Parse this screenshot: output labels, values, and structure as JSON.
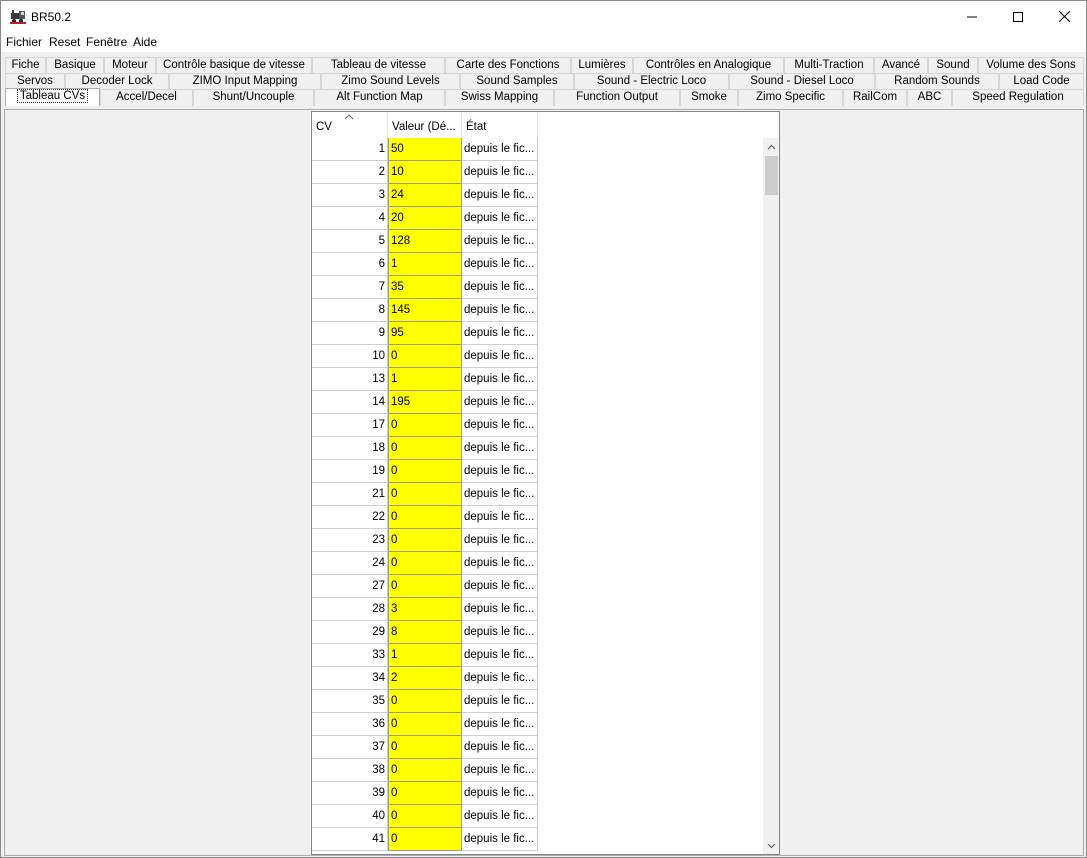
{
  "window": {
    "title": "BR50.2"
  },
  "menu": [
    "Fichier",
    "Reset",
    "Fenêtre",
    "Aide"
  ],
  "tabs": {
    "row1": [
      "Fiche",
      "Basique",
      "Moteur",
      "Contrôle basique de vitesse",
      "Tableau de vitesse",
      "Carte des Fonctions",
      "Lumières",
      "Contrôles en Analogique",
      "Multi-Traction",
      "Avancé",
      "Sound",
      "Volume des Sons"
    ],
    "row2": [
      "Servos",
      "Decoder Lock",
      "ZIMO Input Mapping",
      "Zimo Sound Levels",
      "Sound Samples",
      "Sound - Electric Loco",
      "Sound - Diesel Loco",
      "Random Sounds",
      "Load Code"
    ],
    "row3": [
      "Tableau CVs",
      "Accel/Decel",
      "Shunt/Uncouple",
      "Alt Function Map",
      "Swiss Mapping",
      "Function Output",
      "Smoke",
      "Zimo Specific",
      "RailCom",
      "ABC",
      "Speed Regulation"
    ],
    "active": "Tableau CVs"
  },
  "table": {
    "columns": [
      "CV",
      "Valeur (Dé...",
      "État"
    ],
    "rows": [
      {
        "cv": "1",
        "value": "50",
        "state": "depuis le fic..."
      },
      {
        "cv": "2",
        "value": "10",
        "state": "depuis le fic..."
      },
      {
        "cv": "3",
        "value": "24",
        "state": "depuis le fic..."
      },
      {
        "cv": "4",
        "value": "20",
        "state": "depuis le fic..."
      },
      {
        "cv": "5",
        "value": "128",
        "state": "depuis le fic..."
      },
      {
        "cv": "6",
        "value": "1",
        "state": "depuis le fic..."
      },
      {
        "cv": "7",
        "value": "35",
        "state": "depuis le fic..."
      },
      {
        "cv": "8",
        "value": "145",
        "state": "depuis le fic..."
      },
      {
        "cv": "9",
        "value": "95",
        "state": "depuis le fic..."
      },
      {
        "cv": "10",
        "value": "0",
        "state": "depuis le fic..."
      },
      {
        "cv": "13",
        "value": "1",
        "state": "depuis le fic..."
      },
      {
        "cv": "14",
        "value": "195",
        "state": "depuis le fic..."
      },
      {
        "cv": "17",
        "value": "0",
        "state": "depuis le fic..."
      },
      {
        "cv": "18",
        "value": "0",
        "state": "depuis le fic..."
      },
      {
        "cv": "19",
        "value": "0",
        "state": "depuis le fic..."
      },
      {
        "cv": "21",
        "value": "0",
        "state": "depuis le fic..."
      },
      {
        "cv": "22",
        "value": "0",
        "state": "depuis le fic..."
      },
      {
        "cv": "23",
        "value": "0",
        "state": "depuis le fic..."
      },
      {
        "cv": "24",
        "value": "0",
        "state": "depuis le fic..."
      },
      {
        "cv": "27",
        "value": "0",
        "state": "depuis le fic..."
      },
      {
        "cv": "28",
        "value": "3",
        "state": "depuis le fic..."
      },
      {
        "cv": "29",
        "value": "8",
        "state": "depuis le fic..."
      },
      {
        "cv": "33",
        "value": "1",
        "state": "depuis le fic..."
      },
      {
        "cv": "34",
        "value": "2",
        "state": "depuis le fic..."
      },
      {
        "cv": "35",
        "value": "0",
        "state": "depuis le fic..."
      },
      {
        "cv": "36",
        "value": "0",
        "state": "depuis le fic..."
      },
      {
        "cv": "37",
        "value": "0",
        "state": "depuis le fic..."
      },
      {
        "cv": "38",
        "value": "0",
        "state": "depuis le fic..."
      },
      {
        "cv": "39",
        "value": "0",
        "state": "depuis le fic..."
      },
      {
        "cv": "40",
        "value": "0",
        "state": "depuis le fic..."
      },
      {
        "cv": "41",
        "value": "0",
        "state": "depuis le fic..."
      }
    ]
  },
  "colors": {
    "value_cell": "#ffff00",
    "window_bg": "#f0f0f0"
  },
  "icons": {
    "app": "locomotive-icon",
    "minimize": "minimize-icon",
    "maximize": "maximize-icon",
    "close": "close-icon",
    "sort": "sort-ascending-icon",
    "scroll_up": "chevron-up-icon",
    "scroll_down": "chevron-down-icon"
  }
}
